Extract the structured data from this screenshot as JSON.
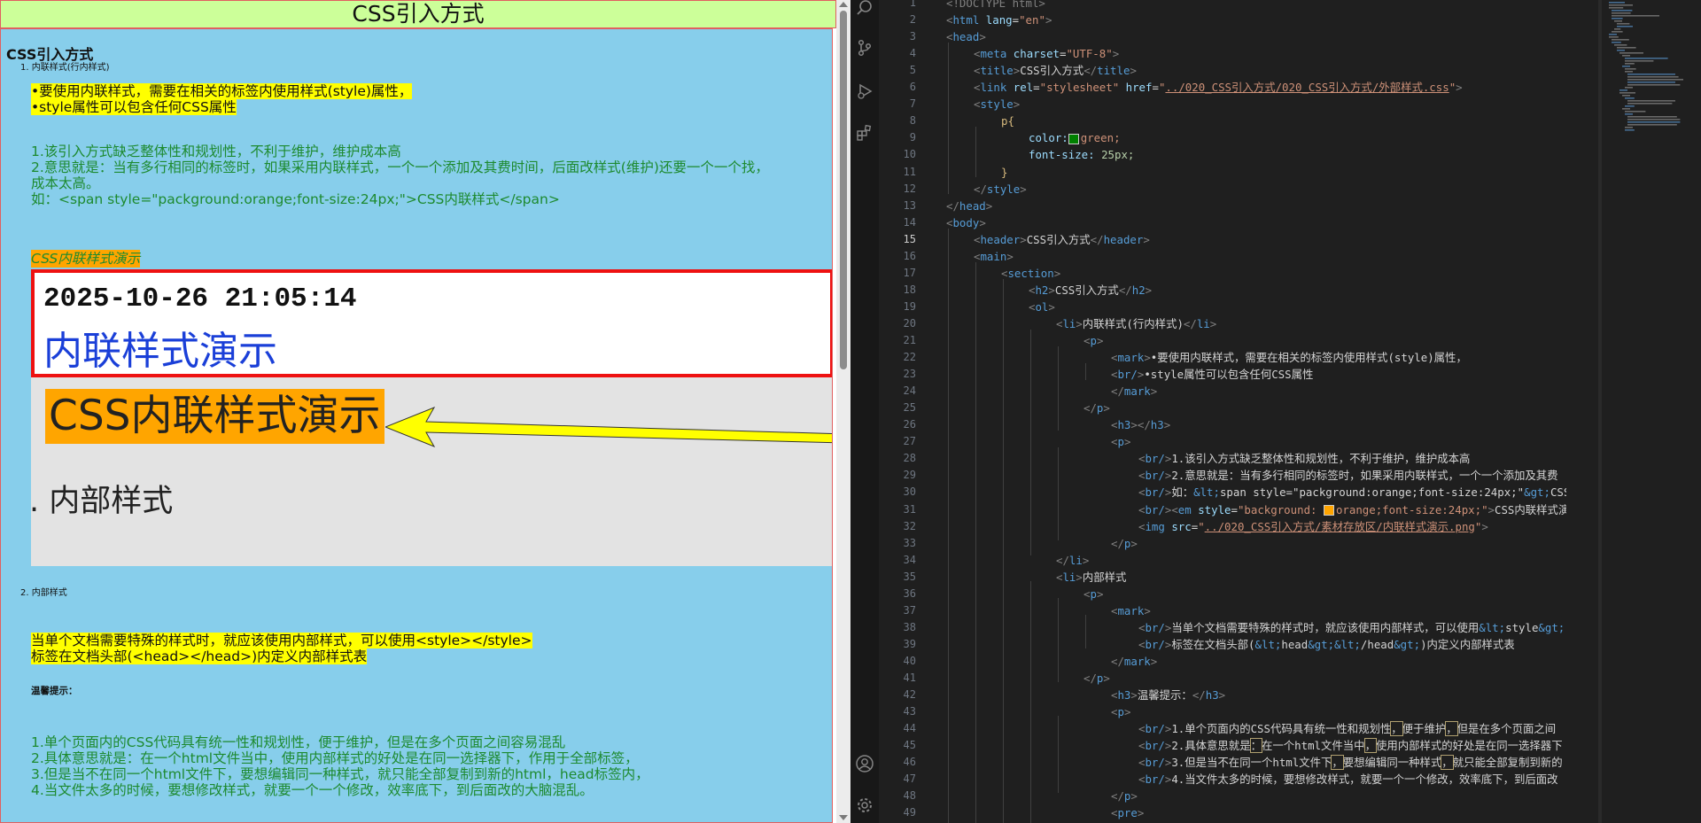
{
  "preview": {
    "header": "CSS引入方式",
    "h2": "CSS引入方式",
    "li1_label": "1. 内联样式(行内样式)",
    "li1_mark_lines": [
      "•要使用内联样式，需要在相关的标签内使用样式(style)属性，",
      "•style属性可以包含任何CSS属性"
    ],
    "li1_green_lines": [
      "1.该引入方式缺乏整体性和规划性，不利于维护，维护成本高",
      "2.意思就是：当有多行相同的标签时，如果采用内联样式，一个一个添加及其费时间，后面改样式(维护)还要一个一个找，",
      "成本太高。",
      "如：<span style=\"packground:orange;font-size:24px;\">CSS内联样式</span>"
    ],
    "li1_em": "CSS内联样式演示",
    "image": {
      "timestamp": "2025-10-26 21:05:14",
      "blue_text": "内联样式演示",
      "orange_text": "CSS内联样式演示",
      "bottom_text": ". 内部样式"
    },
    "li2_label": "2. 内部样式",
    "li2_mark_lines": [
      "当单个文档需要特殊的样式时，就应该使用内部样式，可以使用<style></style>",
      "标签在文档头部(<head></head>)内定义内部样式表"
    ],
    "li2_h3": "温馨提示：",
    "li2_green_lines": [
      "1.单个页面内的CSS代码具有统一性和规划性，便于维护，但是在多个页面之间容易混乱",
      "2.具体意思就是：在一个html文件当中，使用内部样式的好处是在同一选择器下，作用于全部标签，",
      "3.但是当不在同一个html文件下，要想编辑同一种样式，就只能全部复制到新的html，head标签内，",
      "4.当文件太多的时候，要想修改样式，就要一个一个修改，效率底下，到后面改的大脑混乱。"
    ]
  },
  "editor": {
    "active_line": 15,
    "line_numbers": [
      "1",
      "2",
      "3",
      "4",
      "5",
      "6",
      "7",
      "8",
      "9",
      "10",
      "11",
      "12",
      "13",
      "14",
      "15",
      "16",
      "17",
      "18",
      "19",
      "20",
      "21",
      "22",
      "23",
      "24",
      "25",
      "26",
      "27",
      "28",
      "29",
      "30",
      "31",
      "32",
      "33",
      "34",
      "35",
      "36",
      "37",
      "38",
      "39",
      "40",
      "41",
      "42",
      "43",
      "44",
      "45",
      "46",
      "47",
      "48",
      "49"
    ],
    "t": {
      "l1": "<!DOCTYPE html>",
      "l2a": "html",
      "l2b": "lang",
      "l2c": "\"en\"",
      "l3": "head",
      "l4a": "meta",
      "l4b": "charset",
      "l4c": "\"UTF-8\"",
      "l5a": "title",
      "l5b": "CSS引入方式",
      "l6a": "link",
      "l6b": "rel",
      "l6c": "\"stylesheet\"",
      "l6d": "href",
      "l6e": "\"",
      "l6f": "../020_CSS引入方式/020_CSS引入方式/外部样式.css",
      "l6g": "\"",
      "l7": "style",
      "l8": "p{",
      "l9a": "color:",
      "l9b": "green;",
      "l10a": "font-size:",
      "l10b": "25px;",
      "l11": "}",
      "l12": "style",
      "l13": "head",
      "l14": "body",
      "l15a": "header",
      "l15b": "CSS引入方式",
      "l16": "main",
      "l17": "section",
      "l18a": "h2",
      "l18b": "CSS引入方式",
      "l19": "ol",
      "l20a": "li",
      "l20b": "内联样式(行内样式)",
      "l21": "p",
      "l22a": "mark",
      "l22b": "•要使用内联样式，需要在相关的标签内使用样式(style)属性，",
      "l23a": "br/",
      "l23b": "•style属性可以包含任何CSS属性",
      "l24": "mark",
      "l25": "p",
      "l26": "h3",
      "l27": "p",
      "l28a": "br/",
      "l28b": "1.该引入方式缺乏整体性和规划性，不利于维护，维护成本高",
      "l29a": "br/",
      "l29b": "2.意思就是：当有多行相同的标签时，如果采用内联样式，一个一个添加及其费",
      "l30a": "br/",
      "l30b": "如：",
      "l30c": "&lt;",
      "l30d": "span style=\"packground:orange;font-size:24px;\"",
      "l30e": "&gt;",
      "l30f": "CSS内联",
      "l31a": "br/",
      "l31b": "em",
      "l31c": "style",
      "l31d": "\"background: ",
      "l31e": "orange;font-size:24px;\"",
      "l31f": "CSS内联样式演示",
      "l32a": "img",
      "l32b": "src",
      "l32c": "\"",
      "l32d": "../020_CSS引入方式/素材存放区/内联样式演示.png",
      "l32e": "\"",
      "l33": "p",
      "l34": "li",
      "l35a": "li",
      "l35b": "内部样式",
      "l36": "p",
      "l37": "mark",
      "l38a": "br/",
      "l38b": "当单个文档需要特殊的样式时，就应该使用内部样式，可以使用",
      "l38c": "&lt;",
      "l38d": "style",
      "l38e": "&gt;",
      "l39a": "br/",
      "l39b": "标签在文档头部(",
      "l39c": "&lt;",
      "l39d": "head",
      "l39e": "&gt;&lt;",
      "l39f": "/head",
      "l39g": "&gt;",
      "l39h": ")内定义内部样式表",
      "l40": "mark",
      "l41": "p",
      "l42a": "h3",
      "l42b": "温馨提示：",
      "l43": "p",
      "l44a": "br/",
      "l44b": "1.单个页面内的CSS代码具有统一性和规划性",
      "l44c": "，",
      "l44d": "便于维护",
      "l44e": "，",
      "l44f": "但是在多个页面之间",
      "l45a": "br/",
      "l45b": "2.具体意思就是",
      "l45c": "：",
      "l45d": "在一个html文件当中",
      "l45e": "，",
      "l45f": "使用内部样式的好处是在同一选择器下",
      "l46a": "br/",
      "l46b": "3.但是当不在同一个html文件下",
      "l46c": "，",
      "l46d": "要想编辑同一种样式",
      "l46e": "，",
      "l46f": "就只能全部复制到新的",
      "l47a": "br/",
      "l47b": "4.当文件太多的时候，要想修改样式，就要一个一个修改，效率底下，到后面改",
      "l48": "p",
      "l49": "pre"
    }
  },
  "icons": [
    "search-icon",
    "source-control-icon",
    "run-debug-icon",
    "extensions-icon",
    "account-icon",
    "settings-gear-icon"
  ],
  "colors": {
    "swatch_green": "#008000",
    "swatch_orange": "#ffa500"
  }
}
